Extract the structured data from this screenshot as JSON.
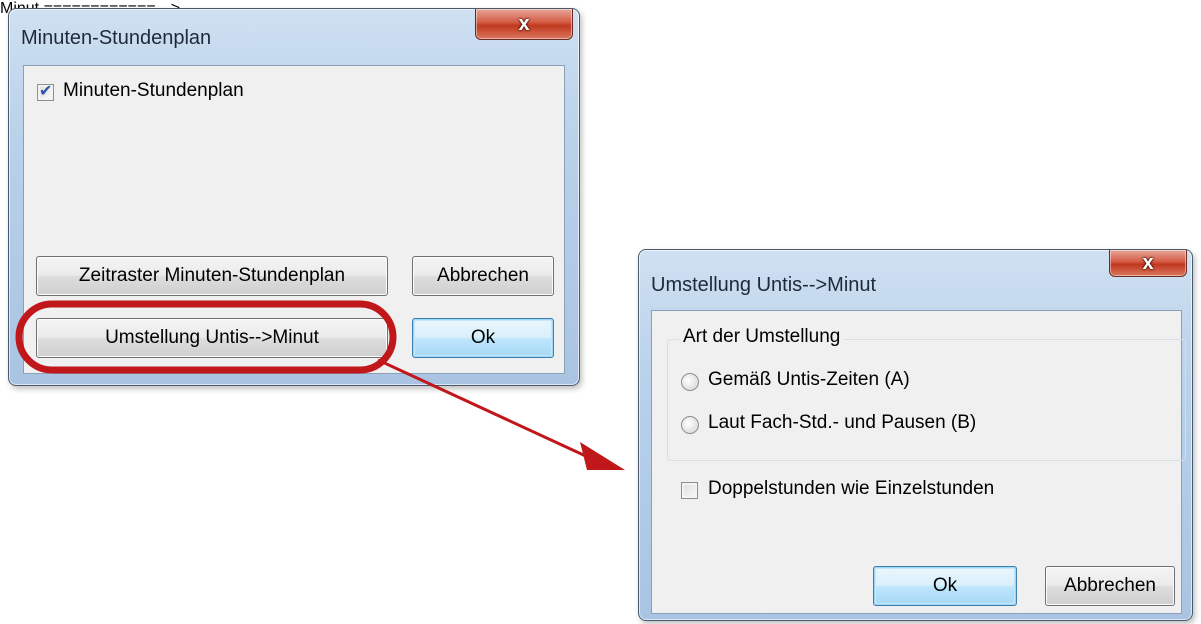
{
  "dialog_main": {
    "title": "Minuten-Stundenplan",
    "close_glyph": "x",
    "checkbox_label": "Minuten-Stundenplan",
    "checkbox_checked": true,
    "btn_zeitraster": "Zeitraster Minuten-Stundenplan",
    "btn_abbrechen": "Abbrechen",
    "btn_umstellung": "Umstellung Untis-->Minut",
    "btn_ok": "Ok"
  },
  "dialog_umstellung": {
    "title": "Umstellung Untis-->Minut",
    "close_glyph": "x",
    "group_label": "Art der Umstellung",
    "radio_a": "Gemäß Untis-Zeiten (A)",
    "radio_b": "Laut Fach-Std.- und Pausen (B)",
    "checkbox_label": "Doppelstunden wie Einzelstunden",
    "checkbox_checked": false,
    "btn_ok": "Ok",
    "btn_abbrechen": "Abbrechen"
  },
  "annotation": {
    "highlight_color": "#c0171b",
    "arrow_color": "#c0171b"
  }
}
